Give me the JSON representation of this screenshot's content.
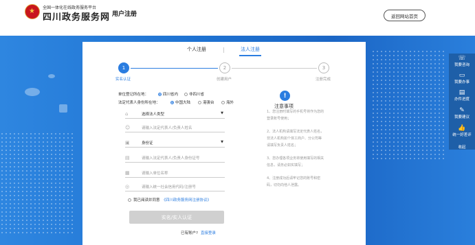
{
  "header": {
    "platform_subtitle": "全国一体化在线政务服务平台",
    "platform_name": "四川政务服务网",
    "page_label": "用户注册",
    "back_button": "返回网站首页"
  },
  "tabs": {
    "personal": "个人注册",
    "legal": "法人注册"
  },
  "steps": [
    {
      "number": "1",
      "label": "实名认证"
    },
    {
      "number": "2",
      "label": "创建用户"
    },
    {
      "number": "3",
      "label": "注册完成"
    }
  ],
  "region": {
    "label": "单位登记所在地：",
    "options": [
      "四川省内",
      "非四川省"
    ],
    "selected": "四川省内"
  },
  "id_region": {
    "label": "法定代表人身份所在地：",
    "options": [
      "中国大陆",
      "港澳台",
      "海外"
    ],
    "selected": "中国大陆"
  },
  "form": {
    "legal_type": "选择法人类型",
    "rep_name_placeholder": "请输入法定代表人/负责人姓名",
    "id_type": "身份证",
    "id_number_placeholder": "请输入法定代表人/负责人身份证号",
    "unit_name_placeholder": "请输入单位名称",
    "credit_code_placeholder": "请输入统一社会信用代码/注册号"
  },
  "agreement": {
    "prefix": "我已阅读并同意",
    "link": "《四川政务服务网注册协议》"
  },
  "submit_label": "实名/实人认证",
  "login": {
    "question": "已有账户?",
    "link": "直接登录"
  },
  "notice": {
    "icon": "!",
    "title": "注意事项",
    "items": [
      "1、您注册时填写的手机号将作为您的登录账号使用；",
      "2、法人机构请填写法定代表人姓名，非法人机构如个体工商户、分公司等请填写负责人姓名；",
      "3、您办理各项业务将使用填写的相关信息，请务必如实填写；",
      "4、注册成功后请牢记您的账号和密码，切勿向他人泄露。"
    ]
  },
  "sidebar": {
    "items": [
      {
        "icon": "phone-icon",
        "label": "我要咨询"
      },
      {
        "icon": "monitor-icon",
        "label": "我要办事"
      },
      {
        "icon": "progress-icon",
        "label": "办件进度"
      },
      {
        "icon": "edit-icon",
        "label": "我要建议"
      },
      {
        "icon": "thumb-icon",
        "label": "统一好差评"
      }
    ],
    "collapse": "收起"
  },
  "colors": {
    "primary": "#2b7de0",
    "backdrop": "#1f73d2",
    "sidebar": "#1e5fa8",
    "emblem": "#c8161d"
  }
}
